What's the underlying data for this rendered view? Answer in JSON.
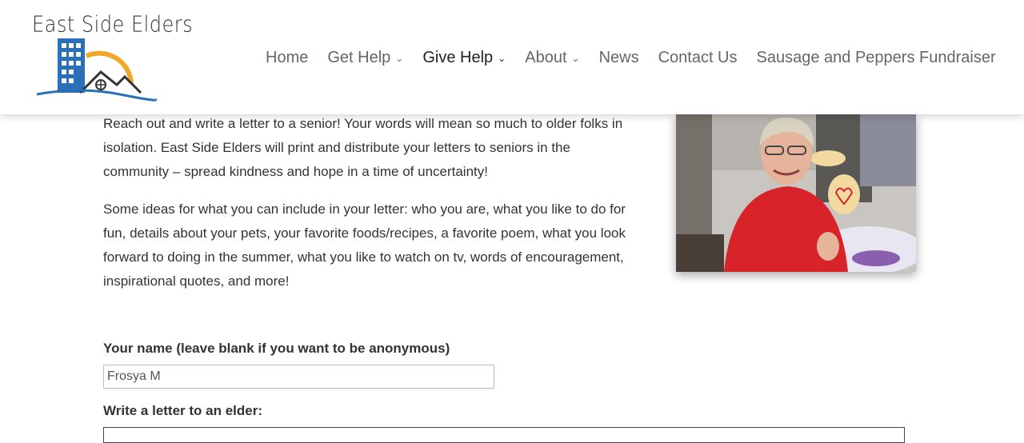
{
  "site": {
    "logo_text": "East Side Elders"
  },
  "nav": {
    "items": [
      {
        "label": "Home",
        "has_dropdown": false
      },
      {
        "label": "Get Help",
        "has_dropdown": true
      },
      {
        "label": "Give Help",
        "has_dropdown": true,
        "active": true
      },
      {
        "label": "About",
        "has_dropdown": true
      },
      {
        "label": "News",
        "has_dropdown": false
      },
      {
        "label": "Contact Us",
        "has_dropdown": false
      },
      {
        "label": "Sausage and Peppers Fundraiser",
        "has_dropdown": false
      }
    ],
    "dropdown_icon": "chevron-down-icon"
  },
  "main": {
    "paragraph1": "Reach out and write a letter to a senior!  Your words will mean so much to older folks in isolation.  East Side Elders will print and distribute your letters to seniors in the community – spread kindness and hope in a time of uncertainty!",
    "paragraph2": "Some ideas for what you can include in your letter:  who you are, what you like to do for fun, details about your pets, your favorite foods/recipes, a favorite poem, what you look forward to doing in the summer, what you like to watch on tv, words of encouragement, inspirational quotes, and more!"
  },
  "form": {
    "name_label": "Your name (leave blank if you want to be anonymous)",
    "name_value": "Frosya M",
    "letter_label": "Write a letter to an elder:"
  },
  "colors": {
    "logo_blue": "#2a6fb8",
    "logo_orange": "#f0a72a",
    "text": "#333333",
    "nav_text": "#666666"
  }
}
